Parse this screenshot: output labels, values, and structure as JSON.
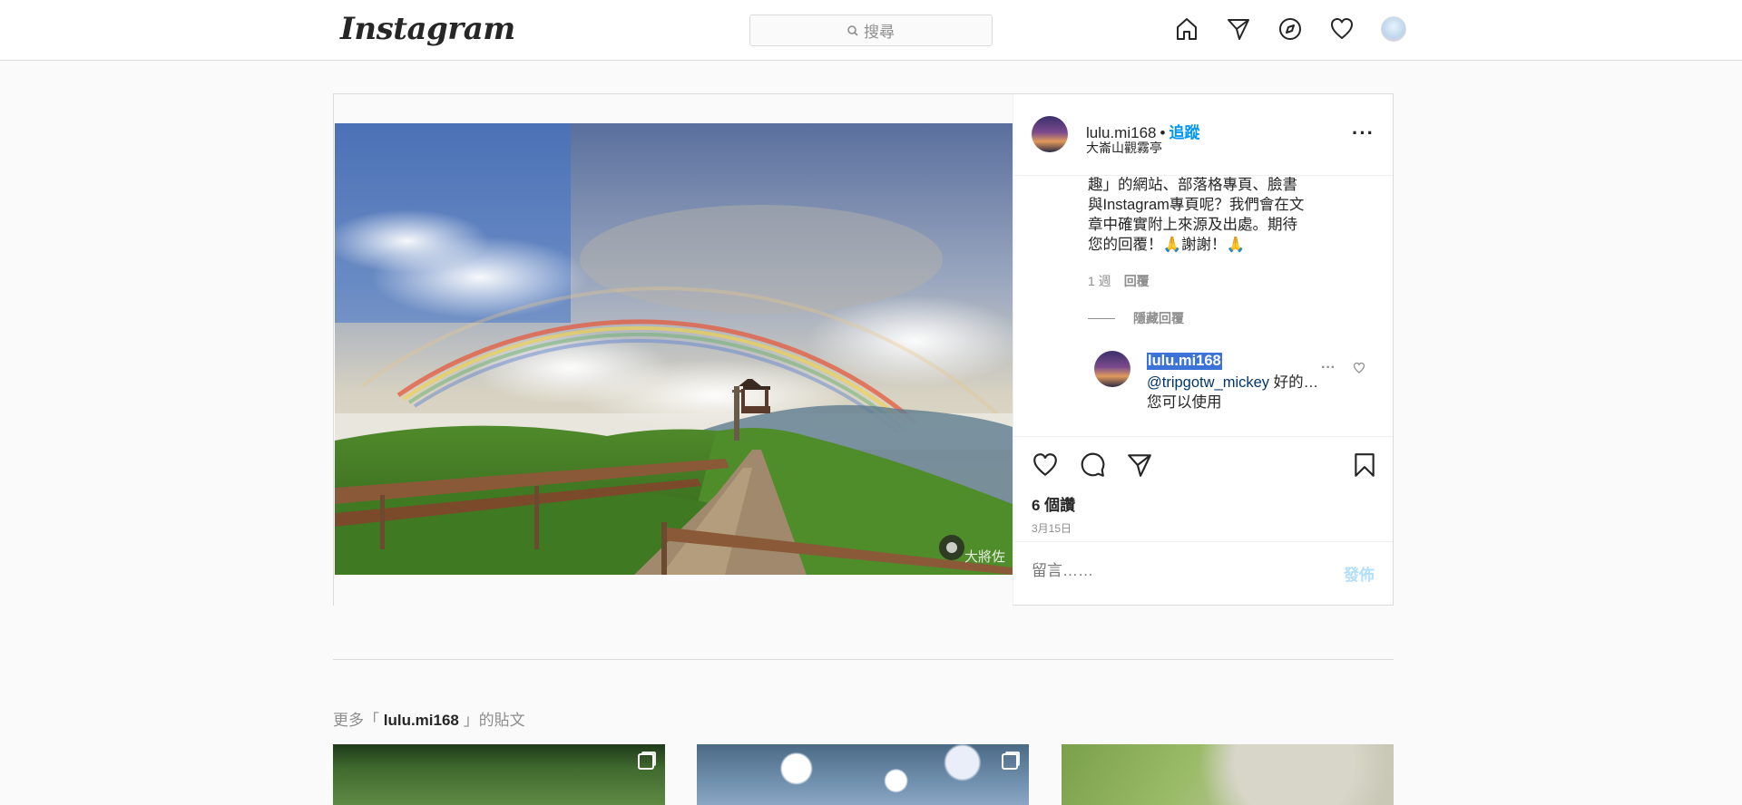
{
  "nav": {
    "logo": "Instagram",
    "search_placeholder": "搜尋",
    "icons": [
      "home-icon",
      "direct-icon",
      "explore-icon",
      "activity-heart-icon",
      "profile-avatar"
    ]
  },
  "post": {
    "username": "lulu.mi168",
    "separator": "•",
    "follow_label": "追蹤",
    "location": "大崙山觀霧亭",
    "comment_text_lines": [
      "趣」的網站、部落格專頁、臉書",
      "與Instagram專頁呢？我們會在文",
      "章中確實附上來源及出處。期待",
      "您的回覆！🙏謝謝！🙏"
    ],
    "comment_age": "1 週",
    "reply_label": "回覆",
    "hide_replies_label": "隱藏回覆",
    "reply": {
      "username": "lulu.mi168",
      "mention": "@tripgotw_mickey",
      "text_after_mention": " 好的…",
      "line2": "您可以使用"
    },
    "likes": "6 個讚",
    "date": "3月15日",
    "comment_placeholder": "留言……",
    "post_button": "發佈",
    "watermark": "大將佐"
  },
  "more": {
    "prefix": "更多「 ",
    "username": "lulu.mi168",
    "suffix": " 」的貼文"
  },
  "colors": {
    "accent": "#0095f6",
    "post_btn_disabled": "#b2dffc",
    "selection": "#3b73d9"
  }
}
